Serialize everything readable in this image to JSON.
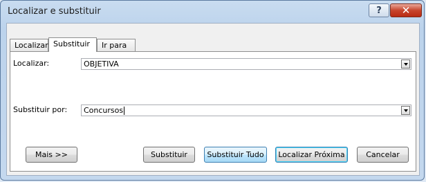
{
  "window": {
    "title": "Localizar e substituir",
    "help_label": "?",
    "close_label": "✕"
  },
  "tabs": [
    {
      "label": "Localizar",
      "active": false
    },
    {
      "label": "Substituir",
      "active": true
    },
    {
      "label": "Ir para",
      "active": false
    }
  ],
  "find": {
    "label": "Localizar:",
    "value": "OBJETIVA"
  },
  "replace": {
    "label": "Substituir por:",
    "value": "Concursos"
  },
  "buttons": {
    "more": "Mais >>",
    "replace": "Substituir",
    "replace_all": "Substituir Tudo",
    "find_next": "Localizar Próxima",
    "cancel": "Cancelar"
  },
  "colors": {
    "window_frame": "#bcd3ec",
    "close_button": "#c7452d",
    "focus_border": "#3c7fb1"
  }
}
